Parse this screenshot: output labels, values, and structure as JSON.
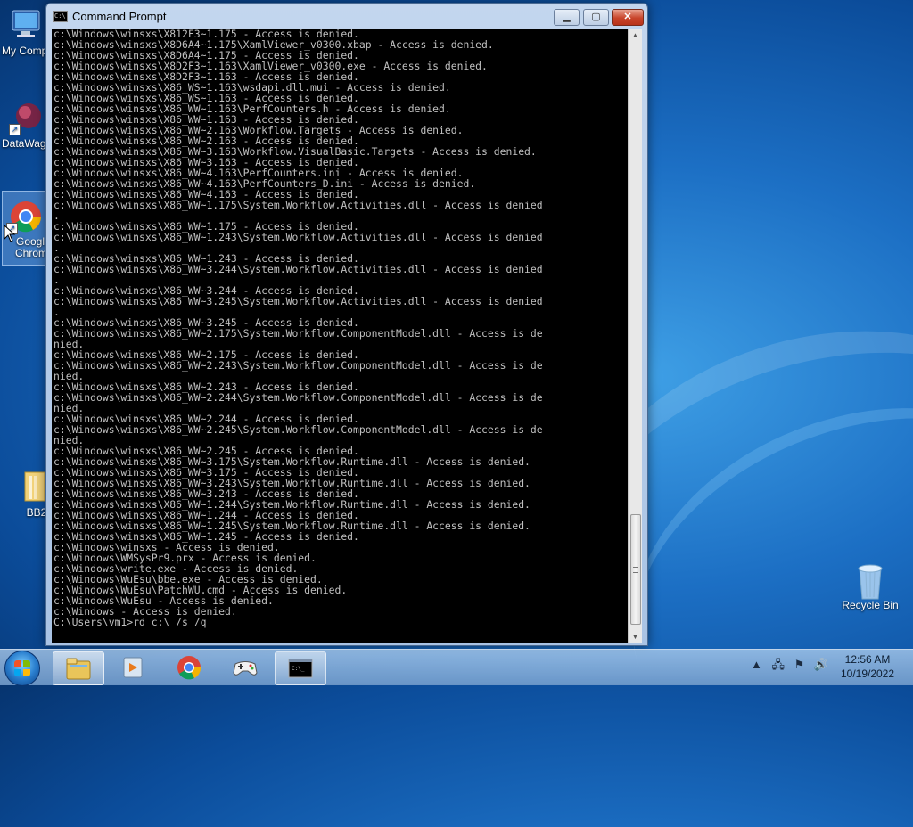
{
  "desktop": {
    "icons": [
      {
        "label": "My Comp"
      },
      {
        "label": "DataWag"
      },
      {
        "label": "Googl Chrom"
      },
      {
        "label": "BB2"
      },
      {
        "label": "Recycle Bin"
      }
    ]
  },
  "window": {
    "title": "Command Prompt",
    "icon": "cmd-icon",
    "buttons": {
      "minimize": "minimize-icon",
      "maximize": "maximize-icon",
      "close": "close-icon"
    },
    "console_lines": [
      "c:\\Windows\\winsxs\\X812F3~1.175 - Access is denied.",
      "c:\\Windows\\winsxs\\X8D6A4~1.175\\XamlViewer_v0300.xbap - Access is denied.",
      "c:\\Windows\\winsxs\\X8D6A4~1.175 - Access is denied.",
      "c:\\Windows\\winsxs\\X8D2F3~1.163\\XamlViewer_v0300.exe - Access is denied.",
      "c:\\Windows\\winsxs\\X8D2F3~1.163 - Access is denied.",
      "c:\\Windows\\winsxs\\X86_WS~1.163\\wsdapi.dll.mui - Access is denied.",
      "c:\\Windows\\winsxs\\X86_WS~1.163 - Access is denied.",
      "c:\\Windows\\winsxs\\X86_WW~1.163\\PerfCounters.h - Access is denied.",
      "c:\\Windows\\winsxs\\X86_WW~1.163 - Access is denied.",
      "c:\\Windows\\winsxs\\X86_WW~2.163\\Workflow.Targets - Access is denied.",
      "c:\\Windows\\winsxs\\X86_WW~2.163 - Access is denied.",
      "c:\\Windows\\winsxs\\X86_WW~3.163\\Workflow.VisualBasic.Targets - Access is denied.",
      "c:\\Windows\\winsxs\\X86_WW~3.163 - Access is denied.",
      "c:\\Windows\\winsxs\\X86_WW~4.163\\PerfCounters.ini - Access is denied.",
      "c:\\Windows\\winsxs\\X86_WW~4.163\\PerfCounters_D.ini - Access is denied.",
      "c:\\Windows\\winsxs\\X86_WW~4.163 - Access is denied.",
      "c:\\Windows\\winsxs\\X86_WW~1.175\\System.Workflow.Activities.dll - Access is denied",
      ".",
      "c:\\Windows\\winsxs\\X86_WW~1.175 - Access is denied.",
      "c:\\Windows\\winsxs\\X86_WW~1.243\\System.Workflow.Activities.dll - Access is denied",
      ".",
      "c:\\Windows\\winsxs\\X86_WW~1.243 - Access is denied.",
      "c:\\Windows\\winsxs\\X86_WW~3.244\\System.Workflow.Activities.dll - Access is denied",
      ".",
      "c:\\Windows\\winsxs\\X86_WW~3.244 - Access is denied.",
      "c:\\Windows\\winsxs\\X86_WW~3.245\\System.Workflow.Activities.dll - Access is denied",
      ".",
      "c:\\Windows\\winsxs\\X86_WW~3.245 - Access is denied.",
      "c:\\Windows\\winsxs\\X86_WW~2.175\\System.Workflow.ComponentModel.dll - Access is de",
      "nied.",
      "c:\\Windows\\winsxs\\X86_WW~2.175 - Access is denied.",
      "c:\\Windows\\winsxs\\X86_WW~2.243\\System.Workflow.ComponentModel.dll - Access is de",
      "nied.",
      "c:\\Windows\\winsxs\\X86_WW~2.243 - Access is denied.",
      "c:\\Windows\\winsxs\\X86_WW~2.244\\System.Workflow.ComponentModel.dll - Access is de",
      "nied.",
      "c:\\Windows\\winsxs\\X86_WW~2.244 - Access is denied.",
      "c:\\Windows\\winsxs\\X86_WW~2.245\\System.Workflow.ComponentModel.dll - Access is de",
      "nied.",
      "c:\\Windows\\winsxs\\X86_WW~2.245 - Access is denied.",
      "c:\\Windows\\winsxs\\X86_WW~3.175\\System.Workflow.Runtime.dll - Access is denied.",
      "c:\\Windows\\winsxs\\X86_WW~3.175 - Access is denied.",
      "c:\\Windows\\winsxs\\X86_WW~3.243\\System.Workflow.Runtime.dll - Access is denied.",
      "c:\\Windows\\winsxs\\X86_WW~3.243 - Access is denied.",
      "c:\\Windows\\winsxs\\X86_WW~1.244\\System.Workflow.Runtime.dll - Access is denied.",
      "c:\\Windows\\winsxs\\X86_WW~1.244 - Access is denied.",
      "c:\\Windows\\winsxs\\X86_WW~1.245\\System.Workflow.Runtime.dll - Access is denied.",
      "c:\\Windows\\winsxs\\X86_WW~1.245 - Access is denied.",
      "c:\\Windows\\winsxs - Access is denied.",
      "c:\\Windows\\WMSysPr9.prx - Access is denied.",
      "c:\\Windows\\write.exe - Access is denied.",
      "c:\\Windows\\WuEsu\\bbe.exe - Access is denied.",
      "c:\\Windows\\WuEsu\\PatchWU.cmd - Access is denied.",
      "c:\\Windows\\WuEsu - Access is denied.",
      "c:\\Windows - Access is denied.",
      ""
    ],
    "prompt_line": "C:\\Users\\vm1>rd c:\\ /s /q"
  },
  "taskbar": {
    "items": [
      {
        "name": "file-explorer-icon"
      },
      {
        "name": "media-player-icon"
      },
      {
        "name": "chrome-icon"
      },
      {
        "name": "game-controller-icon"
      },
      {
        "name": "cmd-icon"
      }
    ],
    "tray": {
      "icons": [
        "show-hidden-icons-icon",
        "network-icon",
        "action-center-flag-icon",
        "volume-icon"
      ]
    },
    "clock": {
      "time": "12:56 AM",
      "date": "10/19/2022"
    }
  }
}
